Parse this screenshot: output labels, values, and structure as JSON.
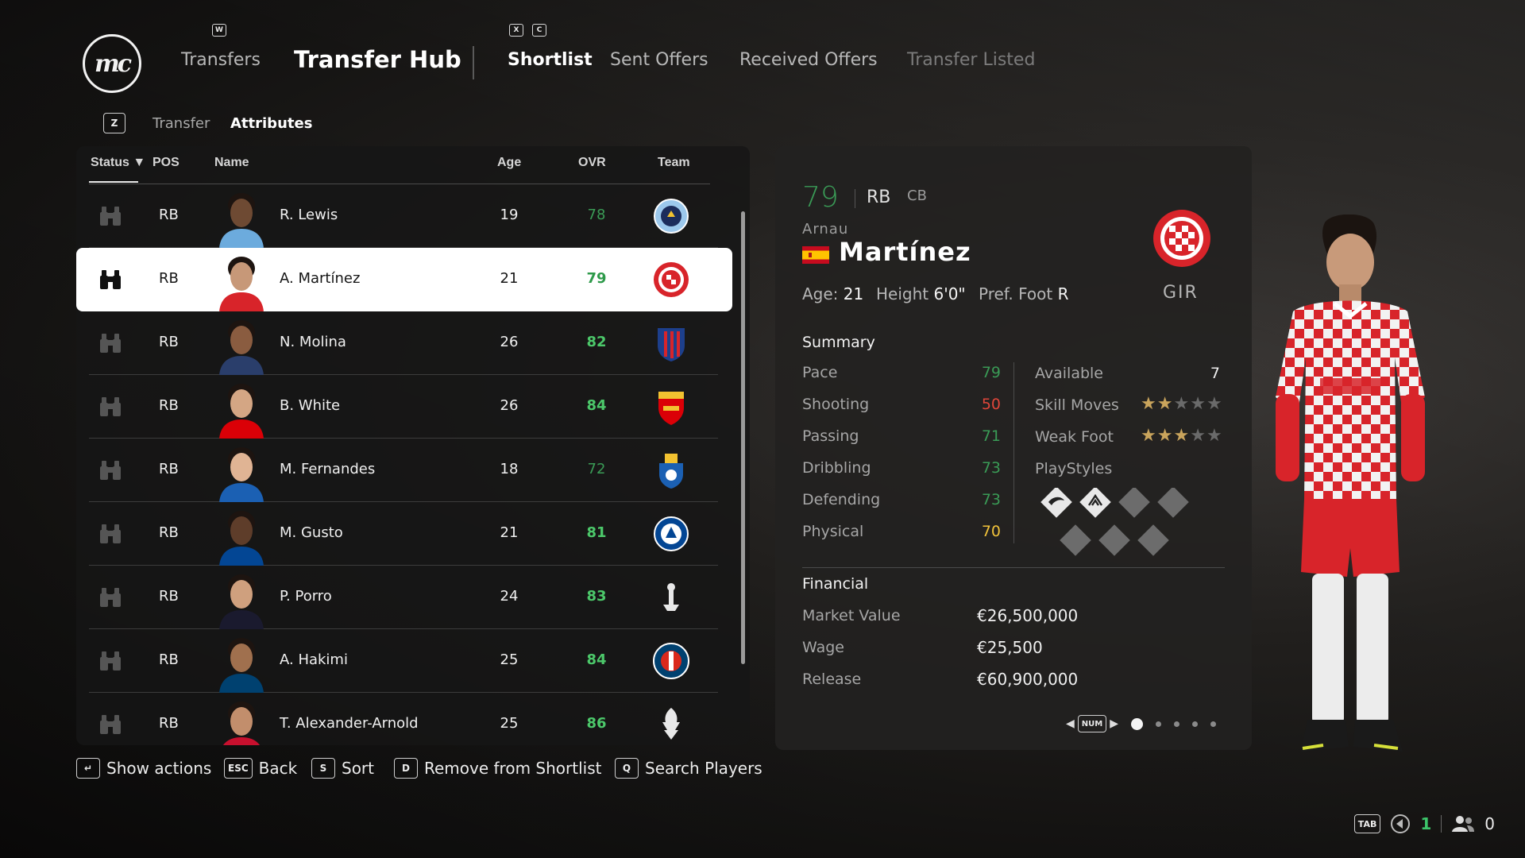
{
  "nav": {
    "logo_text": "mc",
    "transfers_label": "Transfers",
    "title": "Transfer Hub",
    "key_w": "W",
    "key_x": "X",
    "key_c": "C",
    "tabs": [
      {
        "label": "Shortlist",
        "state": "active"
      },
      {
        "label": "Sent Offers",
        "state": "normal"
      },
      {
        "label": "Received Offers",
        "state": "normal"
      },
      {
        "label": "Transfer Listed",
        "state": "disabled"
      }
    ]
  },
  "subtabs": {
    "key": "Z",
    "items": [
      "Transfer",
      "Attributes"
    ],
    "active": "Attributes"
  },
  "table": {
    "columns": {
      "status": "Status ▼",
      "pos": "POS",
      "name": "Name",
      "age": "Age",
      "ovr": "OVR",
      "team": "Team"
    },
    "rows": [
      {
        "pos": "RB",
        "name": "R. Lewis",
        "age": "19",
        "ovr": "78",
        "team": "manchester-city-crest",
        "ovr_color": "#3a9b56"
      },
      {
        "pos": "RB",
        "name": "A. Martínez",
        "age": "21",
        "ovr": "79",
        "team": "girona-crest",
        "ovr_color": "#2e9a4a",
        "selected": true
      },
      {
        "pos": "RB",
        "name": "N. Molina",
        "age": "26",
        "ovr": "82",
        "team": "atletico-madrid-crest",
        "ovr_color": "#4cc86a"
      },
      {
        "pos": "RB",
        "name": "B. White",
        "age": "26",
        "ovr": "84",
        "team": "arsenal-crest",
        "ovr_color": "#4cc86a"
      },
      {
        "pos": "RB",
        "name": "M. Fernandes",
        "age": "18",
        "ovr": "72",
        "team": "fc-porto-crest",
        "ovr_color": "#3a9b56"
      },
      {
        "pos": "RB",
        "name": "M. Gusto",
        "age": "21",
        "ovr": "81",
        "team": "chelsea-crest",
        "ovr_color": "#4cc86a"
      },
      {
        "pos": "RB",
        "name": "P. Porro",
        "age": "24",
        "ovr": "83",
        "team": "tottenham-crest",
        "ovr_color": "#4cc86a"
      },
      {
        "pos": "RB",
        "name": "A. Hakimi",
        "age": "25",
        "ovr": "84",
        "team": "psg-crest",
        "ovr_color": "#4cc86a"
      },
      {
        "pos": "RB",
        "name": "T. Alexander-Arnold",
        "age": "25",
        "ovr": "86",
        "team": "liverpool-crest",
        "ovr_color": "#4cc86a"
      }
    ]
  },
  "player": {
    "ovr": "79",
    "position": "RB",
    "alt_position": "CB",
    "first_name": "Arnau",
    "last_name": "Martínez",
    "nationality_flag": "spain-flag",
    "age_label": "Age:",
    "age": "21",
    "height_label": "Height",
    "height": "6'0\"",
    "foot_label": "Pref. Foot",
    "foot": "R",
    "club_code": "GIR",
    "summary_title": "Summary",
    "stats": [
      {
        "label": "Pace",
        "value": "79",
        "color": "#3a9b56"
      },
      {
        "label": "Shooting",
        "value": "50",
        "color": "#e0463a"
      },
      {
        "label": "Passing",
        "value": "71",
        "color": "#3a9b56"
      },
      {
        "label": "Dribbling",
        "value": "73",
        "color": "#3a9b56"
      },
      {
        "label": "Defending",
        "value": "73",
        "color": "#3a9b56"
      },
      {
        "label": "Physical",
        "value": "70",
        "color": "#f0c23a"
      }
    ],
    "available_label": "Available",
    "available": "7",
    "skill_moves_label": "Skill Moves",
    "skill_moves": 2,
    "weak_foot_label": "Weak Foot",
    "weak_foot": 3,
    "playstyles_label": "PlayStyles",
    "financial_title": "Financial",
    "financial": [
      {
        "label": "Market Value",
        "value": "€26,500,000"
      },
      {
        "label": "Wage",
        "value": "€25,500"
      },
      {
        "label": "Release",
        "value": "€60,900,000"
      }
    ],
    "pager_key": "NUM",
    "pager_active": 1,
    "pager_count": 5
  },
  "footer": [
    {
      "key": "↵",
      "label": "Show actions"
    },
    {
      "key": "ESC",
      "label": "Back"
    },
    {
      "key": "S",
      "label": "Sort"
    },
    {
      "key": "D",
      "label": "Remove from Shortlist"
    },
    {
      "key": "Q",
      "label": "Search Players"
    }
  ],
  "status_bar": {
    "key": "TAB",
    "notifications": "1",
    "friends": "0"
  },
  "colors": {
    "accent_green": "#3a9b56",
    "girona_red": "#d8242a",
    "star_gold": "#c9a45c"
  }
}
